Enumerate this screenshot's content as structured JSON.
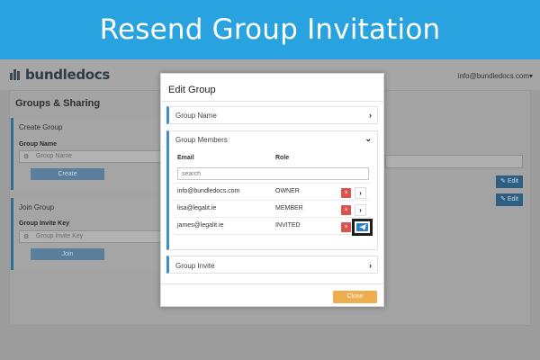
{
  "banner": {
    "title": "Resend Group Invitation"
  },
  "app": {
    "logo_text": "bundledocs",
    "user_email": "info@bundledocs.com",
    "page_title": "Groups & Sharing",
    "create_group": {
      "title": "Create Group",
      "label": "Group Name",
      "placeholder": "Group Name",
      "button": "Create"
    },
    "join_group": {
      "title": "Join Group",
      "label": "Group Invite Key",
      "placeholder": "Group Invite Key",
      "button": "Join"
    },
    "edit_buttons": [
      "Edit",
      "Edit"
    ]
  },
  "modal": {
    "title": "Edit Group",
    "sections": {
      "group_name": "Group Name",
      "group_members": "Group Members",
      "group_invite": "Group Invite"
    },
    "columns": {
      "email": "Email",
      "role": "Role"
    },
    "search_placeholder": "search",
    "members": [
      {
        "email": "info@bundledocs.com",
        "role": "OWNER"
      },
      {
        "email": "lisa@legalit.ie",
        "role": "MEMBER"
      },
      {
        "email": "james@legalit.ie",
        "role": "INVITED"
      }
    ],
    "close_label": "Close"
  },
  "colors": {
    "banner": "#29a3df",
    "accent": "#3a8ed0",
    "delete": "#d9534f",
    "close": "#f0ad4e",
    "resend": "#2f7fc7"
  },
  "icons": {
    "expand": "chevron-right-icon",
    "collapse": "chevron-down-icon",
    "delete": "times-icon",
    "resend": "send-icon",
    "edit": "edit-icon"
  }
}
